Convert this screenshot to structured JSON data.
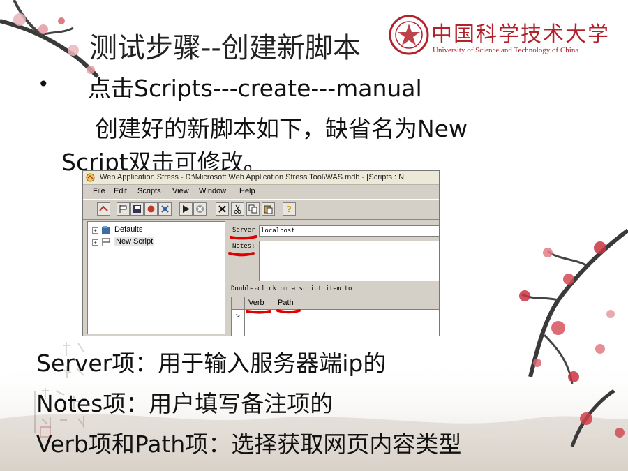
{
  "logo": {
    "chinese": "中国科学技术大学",
    "english": "University of Science and Technology of China"
  },
  "slide": {
    "title": "测试步骤--创建新脚本",
    "bullet_symbol": "•",
    "line1": "点击Scripts---create---manual",
    "line2": "创建好的新脚本如下，缺省名为New",
    "line3": "Script双击可修改。",
    "desc_server": "Server项：用于输入服务器端ip的",
    "desc_notes": "Notes项：用户填写备注项的",
    "desc_verb_path": "Verb项和Path项：选择获取网页内容类型"
  },
  "window": {
    "title": "Web Application Stress - D:\\Microsoft Web Application Stress Tool\\WAS.mdb - [Scripts : N",
    "menu": [
      "File",
      "Edit",
      "Scripts",
      "View",
      "Window",
      "Help"
    ],
    "tree": [
      {
        "label": "Defaults"
      },
      {
        "label": "New Script"
      }
    ],
    "server_label": "Server",
    "server_value": "localhost",
    "notes_label": "Notes:",
    "hint_text": "Double-click on a script item to",
    "grid_columns": [
      "Verb",
      "Path"
    ],
    "row_marker": ">"
  },
  "colors": {
    "accent_red": "#b3212a",
    "annotation_red": "#e00000",
    "window_face": "#d4d0c8"
  },
  "icons": [
    "app-icon",
    "new-icon",
    "flag-icon",
    "save-icon",
    "record-icon",
    "tools-icon",
    "play-icon",
    "stop-icon",
    "delete-icon",
    "cut-icon",
    "copy-icon",
    "paste-icon",
    "help-icon",
    "folder-icon",
    "script-icon"
  ]
}
